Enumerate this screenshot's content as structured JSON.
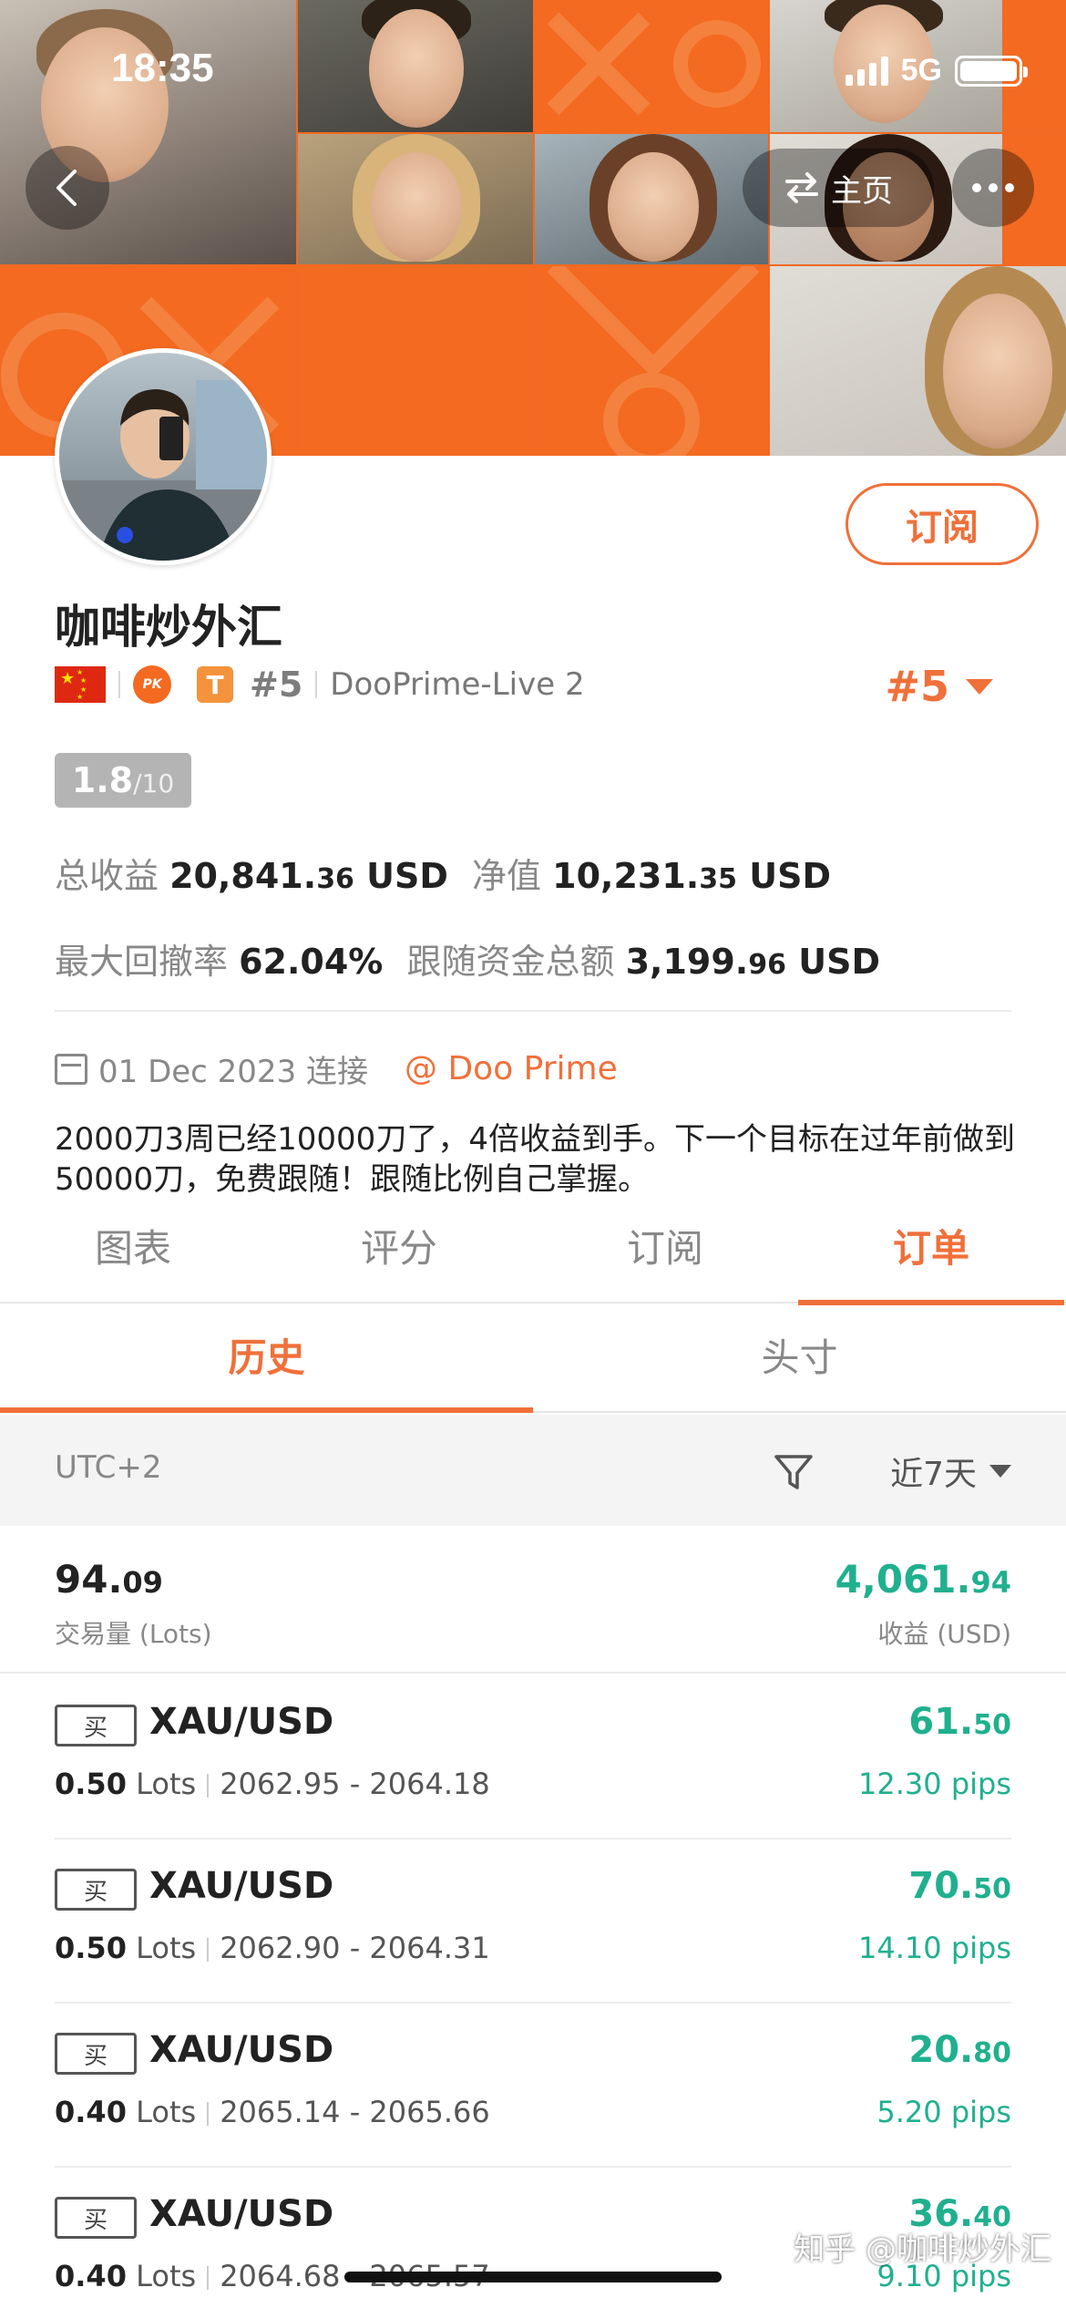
{
  "status": {
    "time": "18:35",
    "network": "5G"
  },
  "nav": {
    "home_label": "主页"
  },
  "profile": {
    "name": "咖啡炒外汇",
    "subscribe_label": "订阅",
    "pk_label": "PK",
    "t_label": "T",
    "rank_small": "#5",
    "server": "DooPrime-Live 2",
    "rank_big": "#5",
    "score": "1.8",
    "score_max": "/10"
  },
  "stats": {
    "total_profit_label": "总收益",
    "total_profit_int": "20,841.",
    "total_profit_dec": "36",
    "total_profit_unit": "USD",
    "equity_label": "净值",
    "equity_int": "10,231.",
    "equity_dec": "35",
    "equity_unit": "USD",
    "max_drawdown_label": "最大回撤率",
    "max_drawdown": "62.04%",
    "follow_funds_label": "跟随资金总额",
    "follow_funds_int": "3,199.",
    "follow_funds_dec": "96",
    "follow_funds_unit": "USD"
  },
  "connect": {
    "date": "01 Dec 2023 连接",
    "broker": "@ Doo Prime"
  },
  "description": "2000刀3周已经10000刀了，4倍收益到手。下一个目标在过年前做到50000刀，免费跟随！跟随比例自己掌握。",
  "tabs": [
    {
      "label": "图表"
    },
    {
      "label": "评分"
    },
    {
      "label": "订阅"
    },
    {
      "label": "订单"
    }
  ],
  "subtabs": [
    {
      "label": "历史"
    },
    {
      "label": "头寸"
    }
  ],
  "filter": {
    "timezone": "UTC+2",
    "range": "近7天"
  },
  "summary": {
    "volume_int": "94.",
    "volume_dec": "09",
    "volume_label": "交易量 (Lots)",
    "profit_int": "4,061.",
    "profit_dec": "94",
    "profit_label": "收益 (USD)"
  },
  "orders": [
    {
      "side": "买",
      "symbol": "XAU/USD",
      "lots": "0.50",
      "lots_unit": "Lots",
      "range": "2062.95 - 2064.18",
      "profit_int": "61.",
      "profit_dec": "50",
      "pips": "12.30 pips"
    },
    {
      "side": "买",
      "symbol": "XAU/USD",
      "lots": "0.50",
      "lots_unit": "Lots",
      "range": "2062.90 - 2064.31",
      "profit_int": "70.",
      "profit_dec": "50",
      "pips": "14.10 pips"
    },
    {
      "side": "买",
      "symbol": "XAU/USD",
      "lots": "0.40",
      "lots_unit": "Lots",
      "range": "2065.14 - 2065.66",
      "profit_int": "20.",
      "profit_dec": "80",
      "pips": "5.20 pips"
    },
    {
      "side": "买",
      "symbol": "XAU/USD",
      "lots": "0.40",
      "lots_unit": "Lots",
      "range": "2064.68 - 2065.57",
      "profit_int": "36.",
      "profit_dec": "40",
      "pips": "9.10 pips"
    }
  ],
  "watermark": "知乎 @咖啡炒外汇",
  "colors": {
    "accent": "#f0703a",
    "profit": "#20b08e",
    "banner": "#f26a21"
  }
}
